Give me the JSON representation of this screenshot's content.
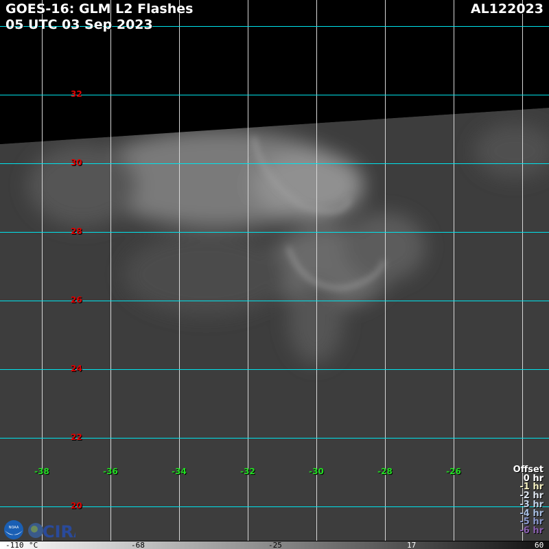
{
  "header": {
    "title": "GOES-16: GLM L2 Flashes",
    "time": "05 UTC 03 Sep 2023",
    "storm_id": "AL122023"
  },
  "lat_labels": [
    "32",
    "30",
    "28",
    "26",
    "24",
    "22",
    "20"
  ],
  "lon_labels": [
    "-38",
    "-36",
    "-34",
    "-32",
    "-30",
    "-28",
    "-26"
  ],
  "legend": {
    "title": "Offset",
    "items": [
      {
        "label": "0 hr",
        "color": "#ffffff"
      },
      {
        "label": "-1 hr",
        "color": "#f2eec0"
      },
      {
        "label": "-2 hr",
        "color": "#dde4ee"
      },
      {
        "label": "-3 hr",
        "color": "#c2d2e8"
      },
      {
        "label": "-4 hr",
        "color": "#a6bde0"
      },
      {
        "label": "-5 hr",
        "color": "#8a98cc"
      },
      {
        "label": "-6 hr",
        "color": "#8a5fb0"
      }
    ]
  },
  "colorbar": {
    "ticks": [
      "-110",
      "°C",
      "-68",
      "-25",
      "17",
      "60"
    ]
  },
  "logos": {
    "noaa": "NOAA",
    "cira": "CIRA"
  }
}
